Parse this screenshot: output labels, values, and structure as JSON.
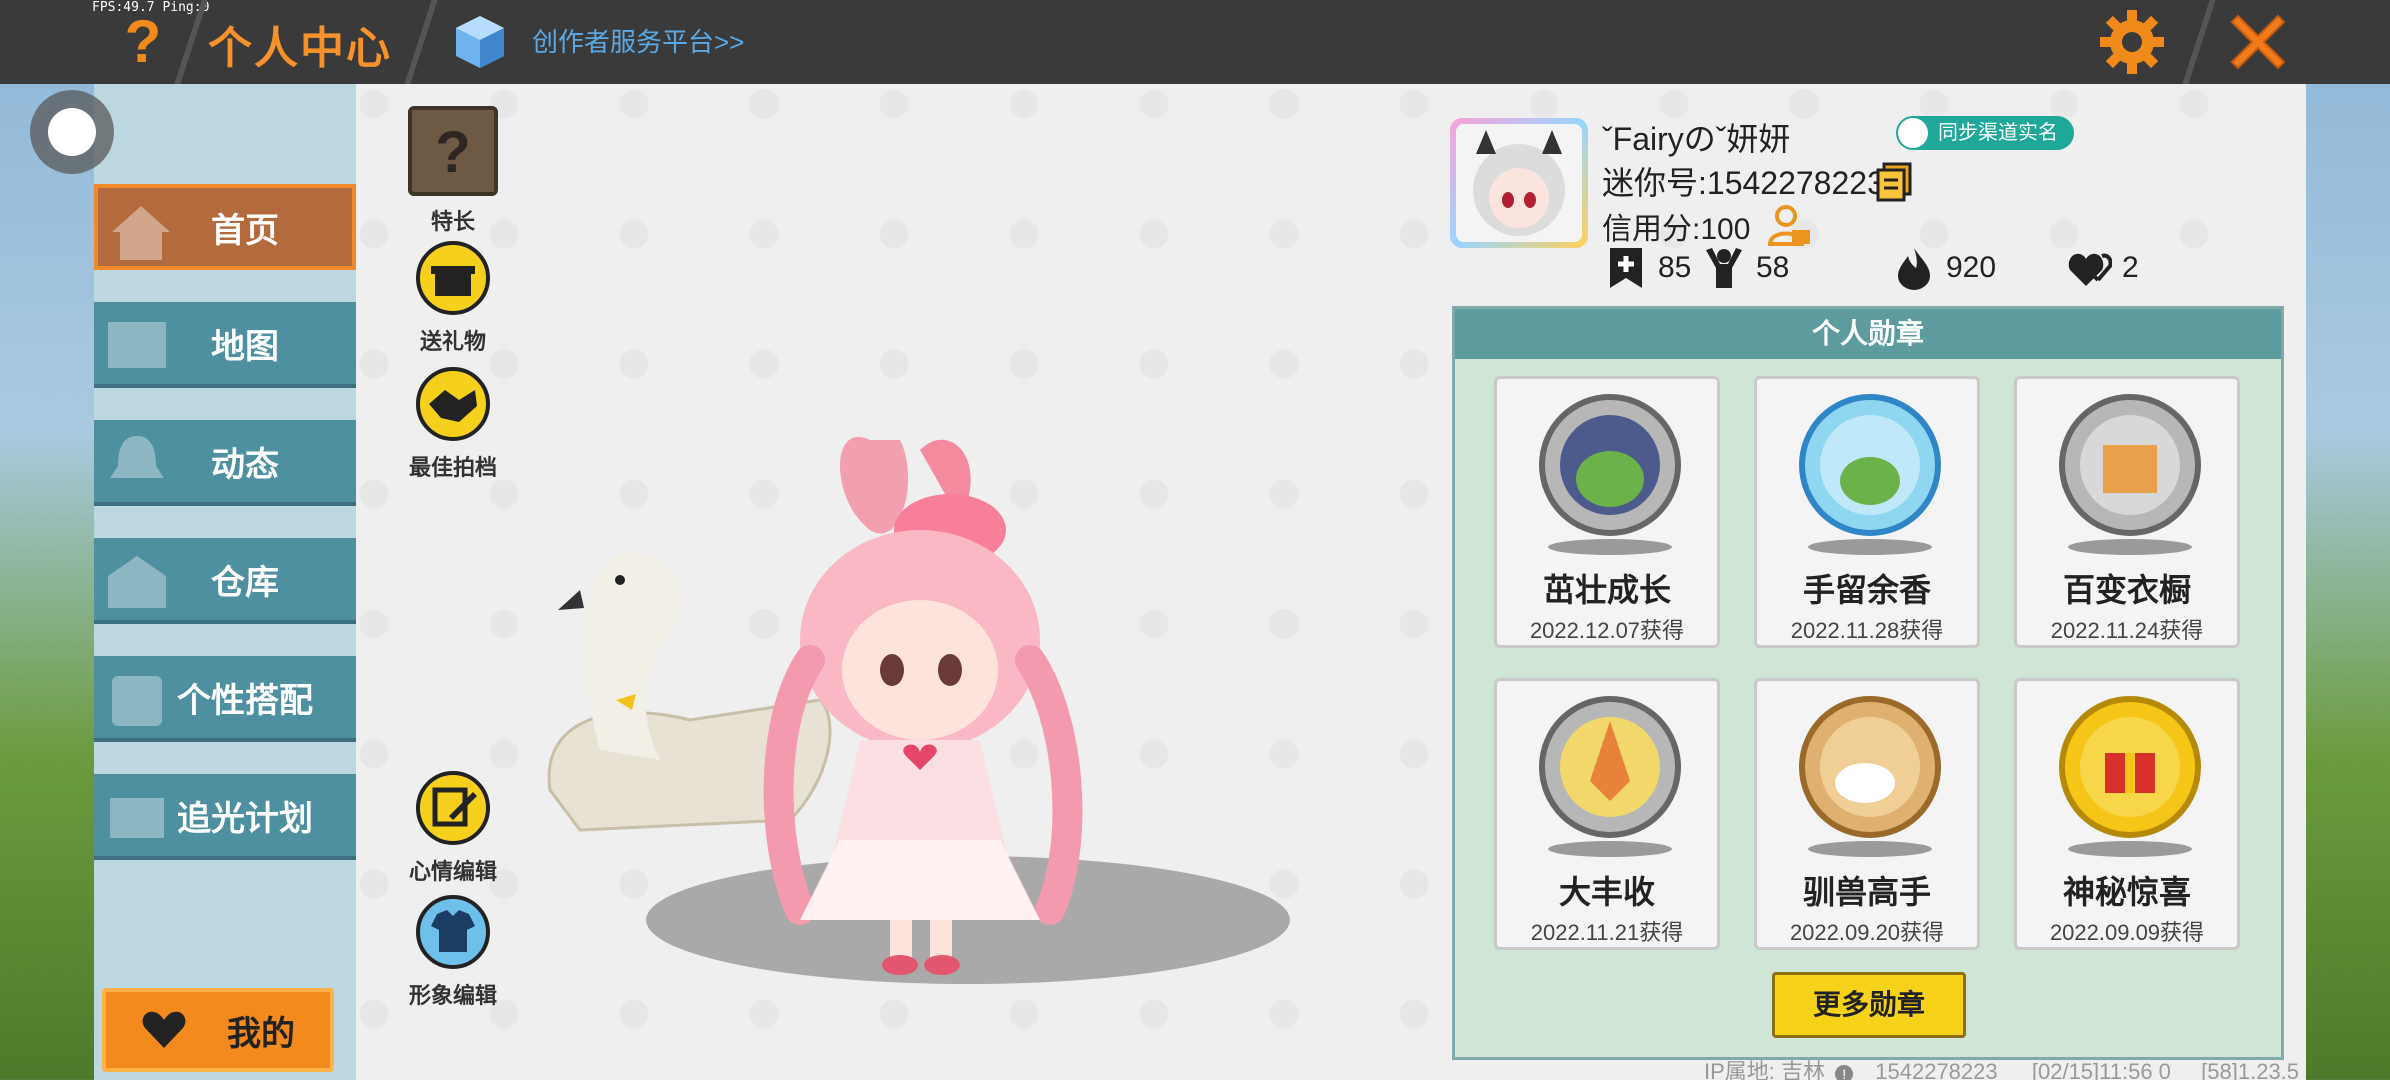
{
  "topbar": {
    "fps_text": "FPS:49.7  Ping:0",
    "title": "个人中心",
    "creator_link": "创作者服务平台>>"
  },
  "nav": {
    "items": [
      {
        "label": "首页",
        "active": true
      },
      {
        "label": "地图",
        "active": false
      },
      {
        "label": "动态",
        "active": false
      },
      {
        "label": "仓库",
        "active": false
      },
      {
        "label": "个性搭配",
        "active": false
      },
      {
        "label": "追光计划",
        "active": false
      }
    ],
    "mine_label": "我的"
  },
  "tools": {
    "talent": "特长",
    "gift": "送礼物",
    "best_photo": "最佳拍档",
    "mood_edit": "心情编辑",
    "image_edit": "形象编辑"
  },
  "profile": {
    "nickname": "ˇFairyのˇ妍妍",
    "mini_id": "迷你号:1542278223",
    "credit": "信用分:100",
    "sync_badge": "同步渠道实名",
    "stats": {
      "plus": "85",
      "fans": "58",
      "fire": "920",
      "likes": "2"
    }
  },
  "medals": {
    "header": "个人勋章",
    "items": [
      {
        "name": "茁壮成长",
        "date": "2022.12.07获得"
      },
      {
        "name": "手留余香",
        "date": "2022.11.28获得"
      },
      {
        "name": "百变衣橱",
        "date": "2022.11.24获得"
      },
      {
        "name": "大丰收",
        "date": "2022.11.21获得"
      },
      {
        "name": "驯兽高手",
        "date": "2022.09.20获得"
      },
      {
        "name": "神秘惊喜",
        "date": "2022.09.09获得"
      }
    ],
    "more_label": "更多勋章"
  },
  "footer": {
    "ip": "IP属地: 吉林",
    "id": "1542278223",
    "time": "[02/15]11:56 0",
    "version": "[58]1.23.5"
  },
  "colors": {
    "accent_orange": "#f7912b",
    "nav_teal": "#4e8fa0",
    "nav_active": "#b36a3c",
    "medal_header": "#5e9b9e",
    "more_button": "#f7d21a"
  }
}
